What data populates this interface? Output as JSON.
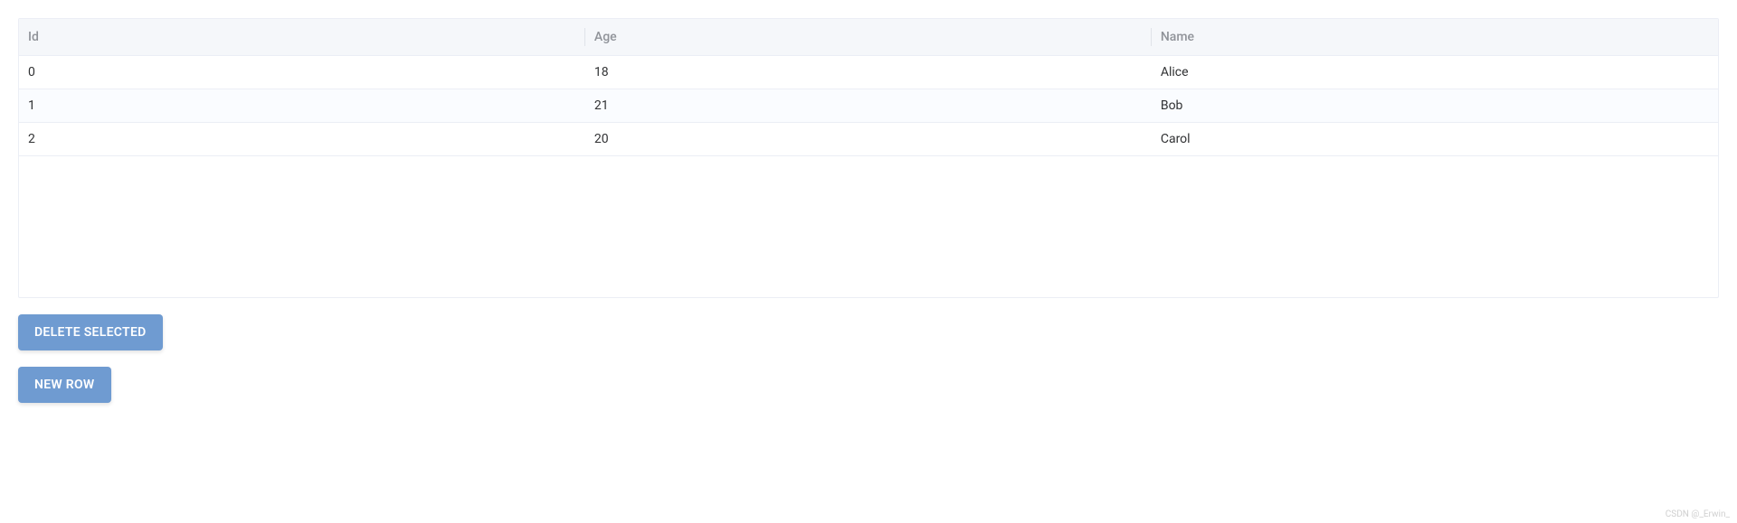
{
  "table": {
    "columns": {
      "id": "Id",
      "age": "Age",
      "name": "Name"
    },
    "rows": [
      {
        "id": "0",
        "age": "18",
        "name": "Alice"
      },
      {
        "id": "1",
        "age": "21",
        "name": "Bob"
      },
      {
        "id": "2",
        "age": "20",
        "name": "Carol"
      }
    ]
  },
  "buttons": {
    "delete_selected": "DELETE SELECTED",
    "new_row": "NEW ROW"
  },
  "watermark": "CSDN @_Erwin_"
}
